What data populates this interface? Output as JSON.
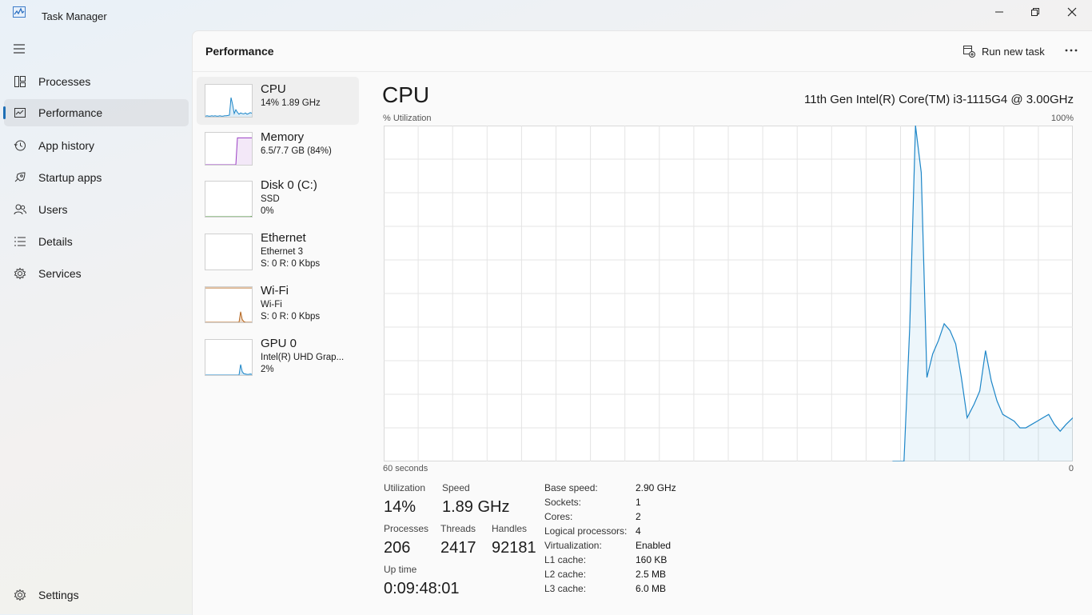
{
  "app": {
    "title": "Task Manager"
  },
  "nav": {
    "items": [
      {
        "label": "Processes",
        "icon": "processes-icon"
      },
      {
        "label": "Performance",
        "icon": "performance-icon"
      },
      {
        "label": "App history",
        "icon": "history-icon"
      },
      {
        "label": "Startup apps",
        "icon": "startup-icon"
      },
      {
        "label": "Users",
        "icon": "users-icon"
      },
      {
        "label": "Details",
        "icon": "details-icon"
      },
      {
        "label": "Services",
        "icon": "services-icon"
      }
    ],
    "settings": "Settings",
    "active": "Performance"
  },
  "header": {
    "title": "Performance",
    "run_task": "Run new task"
  },
  "devices": [
    {
      "name": "CPU",
      "l1": "14%  1.89 GHz",
      "l2": ""
    },
    {
      "name": "Memory",
      "l1": "6.5/7.7 GB (84%)",
      "l2": ""
    },
    {
      "name": "Disk 0 (C:)",
      "l1": "SSD",
      "l2": "0%"
    },
    {
      "name": "Ethernet",
      "l1": "Ethernet 3",
      "l2": "S: 0  R: 0 Kbps"
    },
    {
      "name": "Wi-Fi",
      "l1": "Wi-Fi",
      "l2": "S: 0  R: 0 Kbps"
    },
    {
      "name": "GPU 0",
      "l1": "Intel(R) UHD Grap...",
      "l2": "2%"
    }
  ],
  "cpu": {
    "title": "CPU",
    "model": "11th Gen Intel(R) Core(TM) i3-1115G4 @ 3.00GHz",
    "y_label": "% Utilization",
    "y_max": "100%",
    "x_left": "60 seconds",
    "x_right": "0",
    "stats": {
      "utilization_label": "Utilization",
      "utilization": "14%",
      "speed_label": "Speed",
      "speed": "1.89 GHz",
      "processes_label": "Processes",
      "processes": "206",
      "threads_label": "Threads",
      "threads": "2417",
      "handles_label": "Handles",
      "handles": "92181",
      "uptime_label": "Up time",
      "uptime": "0:09:48:01"
    },
    "info": [
      {
        "k": "Base speed:",
        "v": "2.90 GHz"
      },
      {
        "k": "Sockets:",
        "v": "1"
      },
      {
        "k": "Cores:",
        "v": "2"
      },
      {
        "k": "Logical processors:",
        "v": "4"
      },
      {
        "k": "Virtualization:",
        "v": "Enabled"
      },
      {
        "k": "L1 cache:",
        "v": "160 KB"
      },
      {
        "k": "L2 cache:",
        "v": "2.5 MB"
      },
      {
        "k": "L3 cache:",
        "v": "6.0 MB"
      }
    ]
  },
  "chart_data": {
    "type": "area",
    "ylim": [
      0,
      100
    ],
    "xlim": [
      60,
      0
    ],
    "x": [
      15.7,
      14.7,
      14.2,
      13.7,
      13.2,
      12.7,
      12.2,
      11.7,
      11.2,
      10.7,
      10.2,
      9.7,
      9.2,
      8.6,
      8.1,
      7.6,
      7.1,
      6.6,
      6.1,
      5.6,
      5.1,
      4.6,
      4.1,
      3.6,
      3.1,
      2.6,
      2.1,
      1.6,
      1.1,
      0.6,
      0
    ],
    "values": [
      0,
      0,
      40,
      100,
      86,
      25,
      32,
      36,
      41,
      39,
      35,
      25,
      13,
      17,
      21,
      33,
      24,
      18,
      14,
      13,
      12,
      10,
      10,
      11,
      12,
      13,
      14,
      11,
      9,
      11,
      13
    ],
    "color": "#1d86c8"
  },
  "thumbs": {
    "cpu": [
      2,
      3,
      2,
      2,
      3,
      2,
      3,
      2,
      2,
      3,
      2,
      2,
      3,
      3,
      4,
      5,
      60,
      38,
      10,
      22,
      14,
      8,
      12,
      10,
      9,
      12,
      8,
      10,
      13,
      11
    ],
    "memory": [
      0,
      0,
      0,
      0,
      0,
      0,
      0,
      0,
      0,
      0,
      0,
      0,
      0,
      0,
      0,
      0,
      0,
      0,
      0,
      0,
      84,
      84,
      84,
      84,
      84,
      84,
      84,
      84,
      84,
      84
    ],
    "disk": [
      0,
      0,
      0,
      0,
      0,
      0,
      0,
      0,
      0,
      0,
      0,
      0,
      0,
      0,
      0,
      0,
      0,
      0,
      0,
      0,
      0,
      0,
      0,
      0,
      0,
      0,
      0,
      0,
      0,
      1
    ],
    "wifi": [
      0,
      0,
      0,
      0,
      0,
      0,
      0,
      0,
      0,
      0,
      0,
      0,
      0,
      0,
      0,
      0,
      0,
      0,
      0,
      0,
      0,
      0,
      30,
      8,
      2,
      0,
      0,
      0,
      0,
      0
    ],
    "gpu": [
      0,
      0,
      0,
      0,
      0,
      0,
      0,
      0,
      0,
      0,
      0,
      0,
      0,
      0,
      0,
      0,
      0,
      0,
      0,
      0,
      0,
      0,
      30,
      10,
      4,
      3,
      2,
      2,
      3,
      2
    ]
  }
}
